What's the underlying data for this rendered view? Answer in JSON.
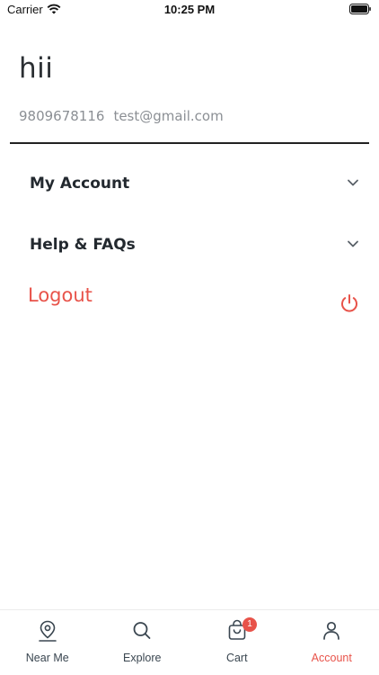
{
  "status_bar": {
    "carrier": "Carrier",
    "time": "10:25 PM"
  },
  "profile": {
    "name": "hii",
    "phone": "9809678116",
    "email": "test@gmail.com"
  },
  "menu": {
    "my_account": "My Account",
    "help_faqs": "Help & FAQs",
    "logout": "Logout"
  },
  "tabs": [
    {
      "label": "Near Me",
      "icon": "location-pin-icon"
    },
    {
      "label": "Explore",
      "icon": "search-icon"
    },
    {
      "label": "Cart",
      "icon": "cart-bag-icon",
      "badge": "1"
    },
    {
      "label": "Account",
      "icon": "user-icon",
      "active": true
    }
  ],
  "colors": {
    "accent": "#e8534a",
    "text_dark": "#23292f",
    "text_muted": "#8b8f94"
  }
}
